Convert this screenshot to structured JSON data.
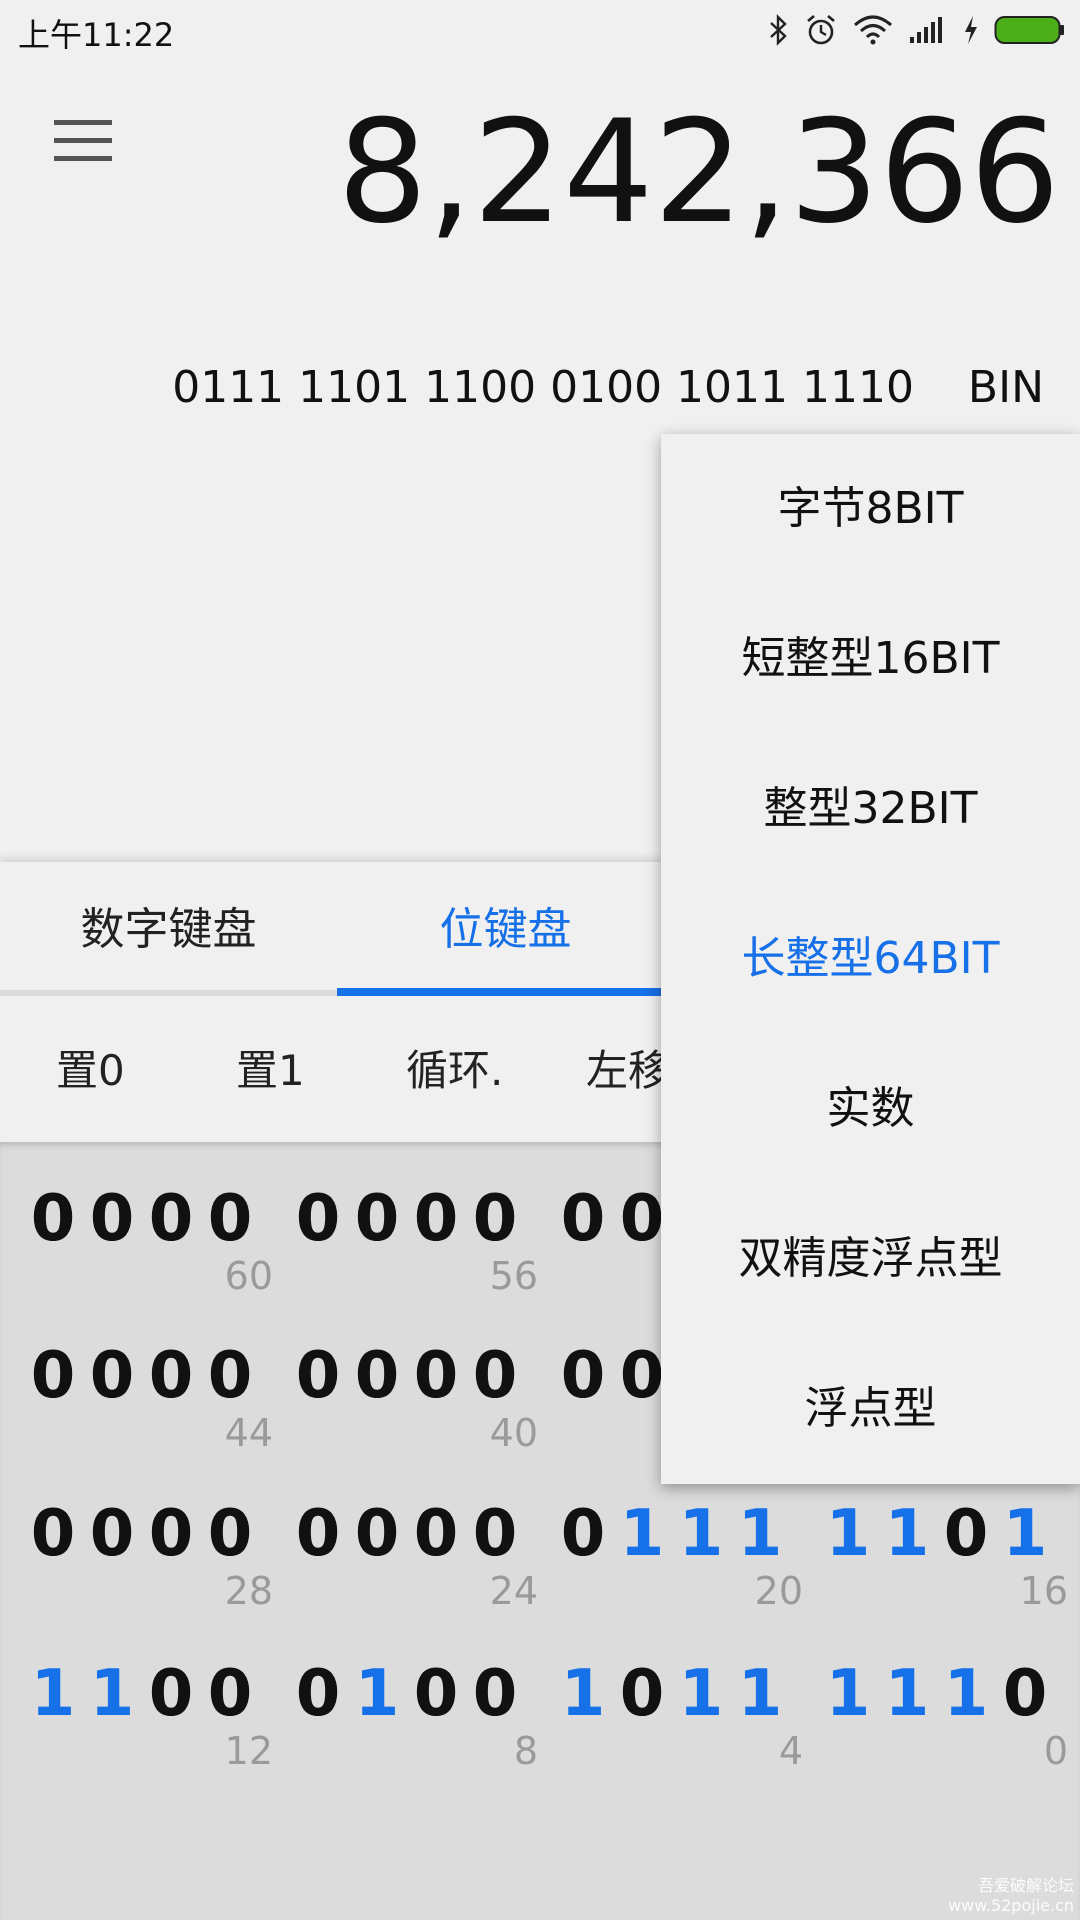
{
  "status_bar": {
    "time": "上午11:22",
    "icons": [
      "bluetooth-icon",
      "alarm-icon",
      "wifi-icon",
      "signal-icon",
      "charging-icon",
      "battery-icon"
    ]
  },
  "display": {
    "result": "8,242,366",
    "binary": "0111 1101 1100 0100 1011 1110",
    "base": "BIN"
  },
  "tabs": [
    {
      "label": "数字键盘",
      "active": false
    },
    {
      "label": "位键盘",
      "active": true
    }
  ],
  "operations": [
    "置0",
    "置1",
    "循环.",
    "左移"
  ],
  "bit_rows": [
    {
      "bits": [
        "0",
        "0",
        "0",
        "0",
        "0",
        "0",
        "0",
        "0",
        "0",
        "0",
        "",
        ""
      ],
      "positions": [
        "60",
        "56",
        "",
        ""
      ]
    },
    {
      "bits": [
        "0",
        "0",
        "0",
        "0",
        "0",
        "0",
        "0",
        "0",
        "0",
        "0",
        "",
        ""
      ],
      "positions": [
        "44",
        "40",
        "",
        ""
      ]
    },
    {
      "bits": [
        "0",
        "0",
        "0",
        "0",
        "0",
        "0",
        "0",
        "0",
        "0",
        "1",
        "1",
        "1",
        "1",
        "1",
        "0",
        "1"
      ],
      "positions": [
        "28",
        "24",
        "20",
        "16"
      ]
    },
    {
      "bits": [
        "1",
        "1",
        "0",
        "0",
        "0",
        "1",
        "0",
        "0",
        "1",
        "0",
        "1",
        "1",
        "1",
        "1",
        "1",
        "0"
      ],
      "positions": [
        "12",
        "8",
        "4",
        "0"
      ]
    }
  ],
  "dropdown": {
    "items": [
      {
        "label": "字节8BIT",
        "selected": false
      },
      {
        "label": "短整型16BIT",
        "selected": false
      },
      {
        "label": "整型32BIT",
        "selected": false
      },
      {
        "label": "长整型64BIT",
        "selected": true
      },
      {
        "label": "实数",
        "selected": false
      },
      {
        "label": "双精度浮点型",
        "selected": false
      },
      {
        "label": "浮点型",
        "selected": false
      }
    ]
  },
  "watermark": {
    "line1": "吾爱破解论坛",
    "line2": "www.52pojie.cn"
  },
  "colors": {
    "accent": "#1670e8",
    "background": "#f0f0f0",
    "grid_background": "#dcdcdc",
    "battery": "#4caf1a"
  }
}
